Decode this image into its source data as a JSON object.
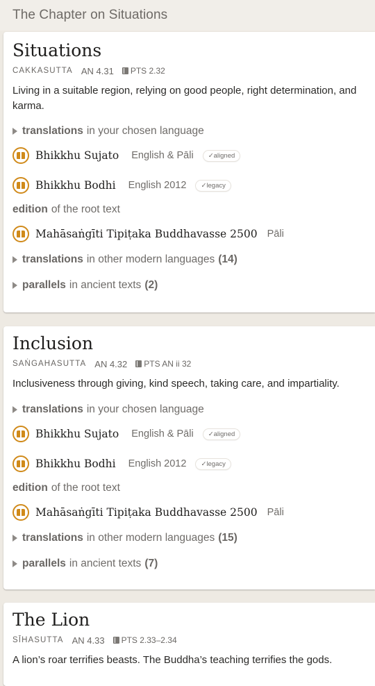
{
  "chapter_title": "The Chapter on Situations",
  "suttas": [
    {
      "title": "Situations",
      "acronym": "Cakkasutta",
      "uid": "AN 4.31",
      "pts": "PTS 2.32",
      "blurb_lines": [
        "Living in a suitable region, relying on good people, right determination, and",
        "karma."
      ],
      "translations_key": "translations",
      "translations_rest": "in your chosen language",
      "translations": [
        {
          "author": "Bhikkhu Sujato",
          "lang": "English & Pāli",
          "badge": "✓aligned"
        },
        {
          "author": "Bhikkhu Bodhi",
          "lang": "English 2012",
          "badge": "✓legacy"
        }
      ],
      "edition_key": "edition",
      "edition_rest": "of the root text",
      "edition": {
        "author": "Mahāsaṅgīti Tipiṭaka Buddhavasse 2500",
        "lang": "Pāli"
      },
      "other_key": "translations",
      "other_rest": "in other modern languages",
      "other_count": "(14)",
      "parallels_key": "parallels",
      "parallels_rest": "in ancient texts",
      "parallels_count": "(2)"
    },
    {
      "title": "Inclusion",
      "acronym": "Saṅgahasutta",
      "uid": "AN 4.32",
      "pts": "PTS AN ii 32",
      "blurb_lines": [
        "Inclusiveness through giving, kind speech, taking care, and impartiality."
      ],
      "translations_key": "translations",
      "translations_rest": "in your chosen language",
      "translations": [
        {
          "author": "Bhikkhu Sujato",
          "lang": "English & Pāli",
          "badge": "✓aligned"
        },
        {
          "author": "Bhikkhu Bodhi",
          "lang": "English 2012",
          "badge": "✓legacy"
        }
      ],
      "edition_key": "edition",
      "edition_rest": "of the root text",
      "edition": {
        "author": "Mahāsaṅgīti Tipiṭaka Buddhavasse 2500",
        "lang": "Pāli"
      },
      "other_key": "translations",
      "other_rest": "in other modern languages",
      "other_count": "(15)",
      "parallels_key": "parallels",
      "parallels_rest": "in ancient texts",
      "parallels_count": "(7)"
    },
    {
      "title": "The Lion",
      "acronym": "Sīhasutta",
      "uid": "AN 4.33",
      "pts": "PTS 2.33–2.34",
      "blurb_lines": [
        "A lion’s roar terrifies beasts. The Buddha’s teaching terrifies the gods."
      ]
    }
  ],
  "colors": {
    "background": "#eeeae3",
    "card": "#ffffff",
    "accent": "#d08a1a",
    "muted_text": "#6f6c69"
  },
  "icons": {
    "section_toggle": "triangle-right-icon",
    "text": "book-circle-icon",
    "pts": "book-icon"
  }
}
